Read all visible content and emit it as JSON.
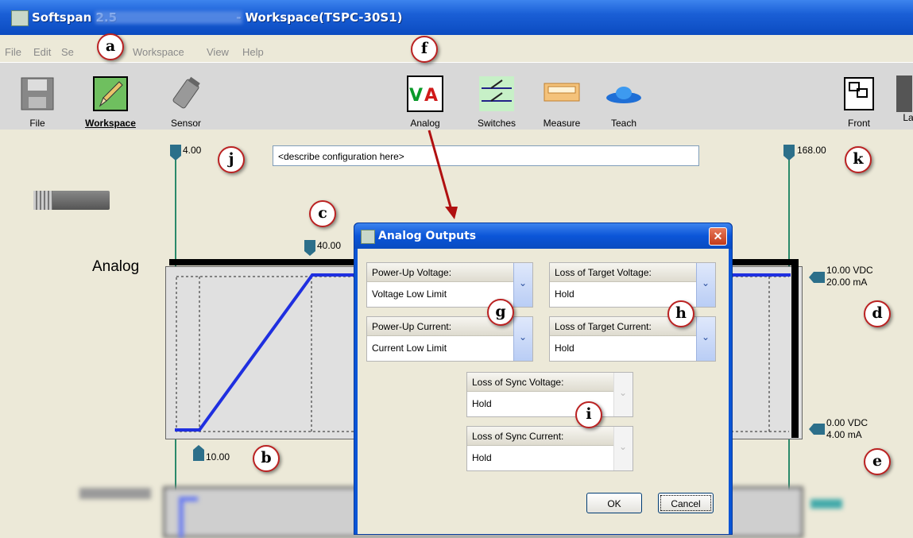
{
  "window": {
    "title": "Softspan 2.5",
    "title_suffix": "- Workspace(TSPC-30S1)"
  },
  "menu": [
    "File",
    "Edit",
    "Se",
    "Workspace",
    "View",
    "Help"
  ],
  "toolbar": {
    "file": "File",
    "workspace": "Workspace",
    "sensor": "Sensor",
    "analog": "Analog",
    "switches": "Switches",
    "measure": "Measure",
    "teach": "Teach",
    "front": "Front",
    "extra": "La"
  },
  "workspace": {
    "config_placeholder": "<describe configuration here>",
    "left_marker": "4.00",
    "right_marker": "168.00",
    "knee_marker": "40.00",
    "low_marker": "10.00",
    "analog_label": "Analog",
    "high_voltage": "10.00 VDC",
    "high_current": "20.00 mA",
    "low_voltage": "0.00 VDC",
    "low_current": "4.00 mA"
  },
  "callouts": {
    "a": "a",
    "b": "b",
    "c": "c",
    "d": "d",
    "e": "e",
    "f": "f",
    "g": "g",
    "h": "h",
    "i": "i",
    "j": "j",
    "k": "k"
  },
  "dialog": {
    "title": "Analog Outputs",
    "close": "✕",
    "powerup_voltage_label": "Power-Up Voltage:",
    "powerup_voltage_value": "Voltage Low Limit",
    "powerup_current_label": "Power-Up Current:",
    "powerup_current_value": "Current Low Limit",
    "lot_voltage_label": "Loss of Target Voltage:",
    "lot_voltage_value": "Hold",
    "lot_current_label": "Loss of Target Current:",
    "lot_current_value": "Hold",
    "los_voltage_label": "Loss of Sync Voltage:",
    "los_voltage_value": "Hold",
    "los_current_label": "Loss of Sync Current:",
    "los_current_value": "Hold",
    "ok": "OK",
    "cancel": "Cancel"
  },
  "colors": {
    "accent": "#0a55d6",
    "trace": "#1f2fe0",
    "marker": "#2c6f8a"
  },
  "icons": [
    "save-icon",
    "pencil-icon",
    "sensor-icon",
    "analog-va-icon",
    "switches-icon",
    "ruler-icon",
    "teach-icon",
    "front-panel-icon"
  ]
}
